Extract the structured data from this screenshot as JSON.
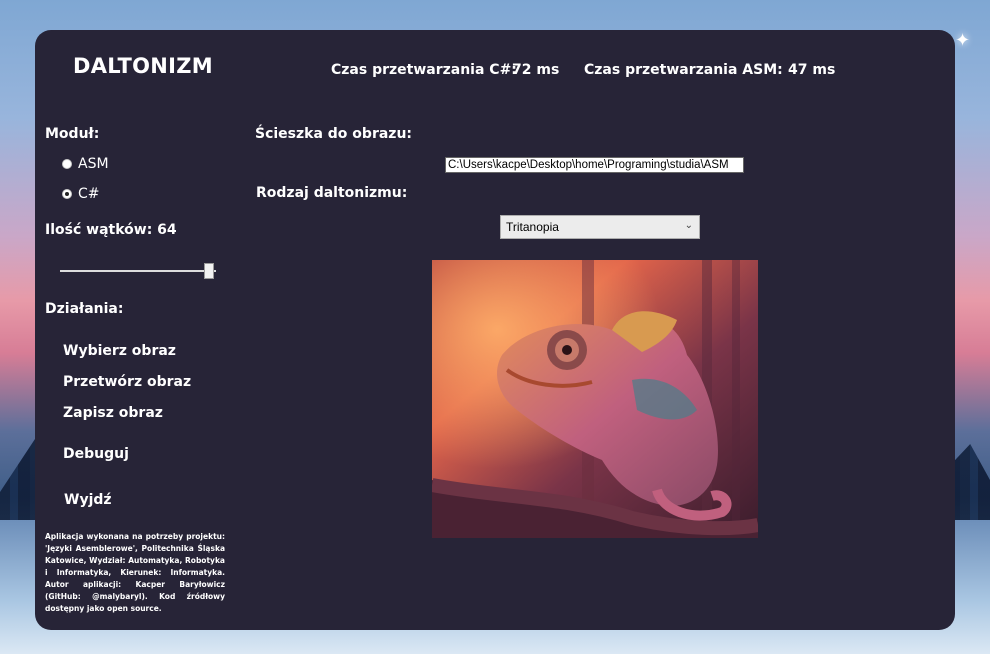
{
  "app": {
    "title": "DALTONIZM"
  },
  "stats": {
    "cs_label": "Czas przetwarzania C#:",
    "cs_value": "72 ms",
    "asm_label": "Czas przetwarzania ASM:",
    "asm_value": "47 ms"
  },
  "module": {
    "label": "Moduł:",
    "options": [
      "ASM",
      "C#"
    ],
    "selected": "C#"
  },
  "threads": {
    "label": "Ilość wątków: 64",
    "value": 64,
    "max": 64
  },
  "actions": {
    "label": "Działania:",
    "items": [
      "Wybierz obraz",
      "Przetwórz obraz",
      "Zapisz obraz",
      "Debuguj",
      "Wyjdź"
    ]
  },
  "about": "Aplikacja wykonana na potrzeby projektu: 'Języki Asemblerowe', Politechnika Śląska Katowice, Wydział: Automatyka, Robotyka i Informatyka, Kierunek: Informatyka. Autor aplikacji: Kacper Baryłowicz (GitHub: @malybaryl). Kod źródłowy dostępny jako open source.",
  "path": {
    "label": "Ścieszka do obrazu:",
    "value": "C:\\Users\\kacpe\\Desktop\\home\\Programing\\studia\\ASM"
  },
  "daltonism": {
    "label": "Rodzaj daltonizmu:",
    "selected": "Tritanopia"
  },
  "colors": {
    "panel": "#272437",
    "text": "#ffffff"
  }
}
